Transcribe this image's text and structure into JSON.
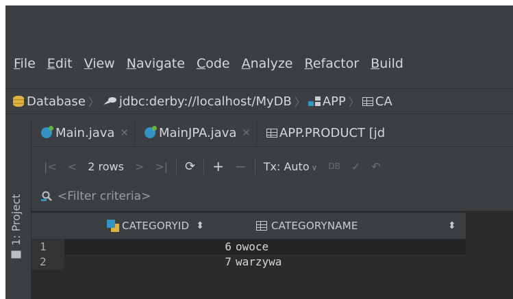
{
  "menu": [
    "File",
    "Edit",
    "View",
    "Navigate",
    "Code",
    "Analyze",
    "Refactor",
    "Build"
  ],
  "breadcrumb": {
    "database": "Database",
    "connection": "jdbc:derby://localhost/MyDB",
    "schema": "APP",
    "table": "CA"
  },
  "sidebar": {
    "project_tab": "1: Project"
  },
  "tabs": [
    {
      "label": "Main.java"
    },
    {
      "label": "MainJPA.java"
    },
    {
      "label": "APP.PRODUCT [jd"
    }
  ],
  "toolbar": {
    "rows_label": "2 rows",
    "tx_label": "Tx: Auto"
  },
  "filter": {
    "placeholder": "<Filter criteria>"
  },
  "table": {
    "columns": [
      "CATEGORYID",
      "CATEGORYNAME"
    ],
    "rows": [
      {
        "num": "1",
        "categoryid": "6",
        "categoryname": "owoce"
      },
      {
        "num": "2",
        "categoryid": "7",
        "categoryname": "warzywa"
      }
    ]
  }
}
